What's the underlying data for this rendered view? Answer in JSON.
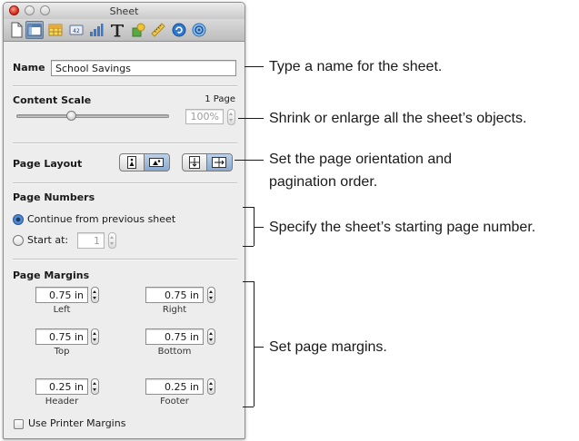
{
  "window": {
    "title": "Sheet"
  },
  "toolbar": {
    "icons": [
      "document-icon",
      "sheet-icon",
      "table-icon",
      "format-icon",
      "chart-icon",
      "text-icon",
      "shape-icon",
      "ruler-icon",
      "link-icon",
      "info-icon"
    ]
  },
  "name_row": {
    "label": "Name",
    "value": "School Savings"
  },
  "content_scale": {
    "label": "Content Scale",
    "pages": "1 Page",
    "zoom_value": "100%",
    "slider_level": 0.36
  },
  "page_layout": {
    "label": "Page Layout"
  },
  "page_numbers": {
    "label": "Page Numbers",
    "option_continue": "Continue from previous sheet",
    "option_start": "Start at:",
    "start_value": "1"
  },
  "page_margins": {
    "label": "Page Margins",
    "left": {
      "value": "0.75 in",
      "caption": "Left"
    },
    "right": {
      "value": "0.75 in",
      "caption": "Right"
    },
    "top": {
      "value": "0.75 in",
      "caption": "Top"
    },
    "bottom": {
      "value": "0.75 in",
      "caption": "Bottom"
    },
    "header": {
      "value": "0.25 in",
      "caption": "Header"
    },
    "footer": {
      "value": "0.25 in",
      "caption": "Footer"
    },
    "use_printer_margins": "Use Printer Margins"
  },
  "callouts": {
    "name": "Type a name for the sheet.",
    "scale": "Shrink or enlarge all the sheet’s objects.",
    "layout_line1": "Set the page orientation and",
    "layout_line2": "pagination order.",
    "numbers": "Specify the sheet’s starting page number.",
    "margins": "Set page margins."
  },
  "colors": {
    "accent": "#2f6fbf",
    "close": "#d0200f"
  }
}
